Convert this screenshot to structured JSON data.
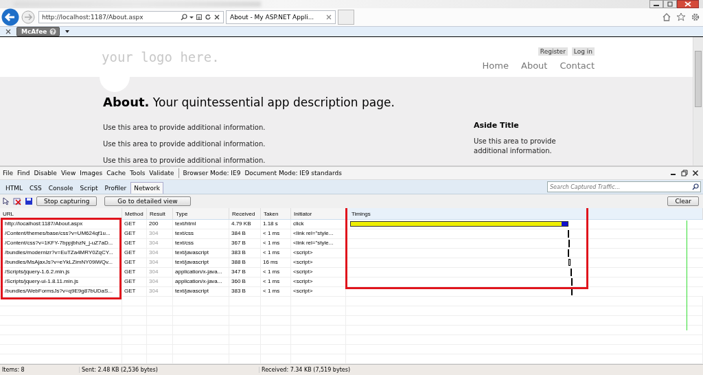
{
  "browser": {
    "address": "http://localhost:1187/About.aspx",
    "tab": "About - My ASP.NET Appli...",
    "addon": "McAfee"
  },
  "page": {
    "logo": "your logo here.",
    "account_links": [
      "Register",
      "Log in"
    ],
    "nav": [
      "Home",
      "About",
      "Contact"
    ],
    "heading": {
      "title": "About.",
      "subtitle": "Your quintessential app description page."
    },
    "paragraphs": [
      "Use this area to provide additional information.",
      "Use this area to provide additional information.",
      "Use this area to provide additional information."
    ],
    "aside": {
      "title": "Aside Title",
      "text": "Use this area to provide additional information."
    }
  },
  "devtools": {
    "menu": [
      "File",
      "Find",
      "Disable",
      "View",
      "Images",
      "Cache",
      "Tools",
      "Validate"
    ],
    "modes": [
      "Browser Mode: IE9",
      "Document Mode: IE9 standards"
    ],
    "tabs": [
      {
        "label": "HTML",
        "selected": false
      },
      {
        "label": "CSS",
        "selected": false
      },
      {
        "label": "Console",
        "selected": false
      },
      {
        "label": "Script",
        "selected": false
      },
      {
        "label": "Profiler",
        "selected": false
      },
      {
        "label": "Network",
        "selected": true
      }
    ],
    "search": {
      "placeholder": "Search Captured Traffic..."
    },
    "buttons": [
      "Stop capturing",
      "Go to detailed view"
    ],
    "clear_button": "Clear",
    "columns": [
      "URL",
      "Method",
      "Result",
      "Type",
      "Received",
      "Taken",
      "Initiator",
      "Timings"
    ],
    "rows": [
      {
        "url": "http://localhost:1187/About.aspx",
        "method": "GET",
        "result": "200",
        "cached": false,
        "type": "text/html",
        "received": "4.79 KB",
        "taken": "1.18 s",
        "initiator": "click",
        "kind": "bar",
        "level": 0.625
      },
      {
        "url": "/Content/themes/base/css?v=UM624qf1u...",
        "method": "GET",
        "result": "304",
        "cached": true,
        "type": "text/css",
        "received": "384 B",
        "taken": "< 1 ms",
        "initiator": "<link rel=\"style...",
        "kind": "tick",
        "level": 0.628
      },
      {
        "url": "/Content/css?v=1KFY-7bppjbhzN_j-uZ7aD...",
        "method": "GET",
        "result": "304",
        "cached": true,
        "type": "text/css",
        "received": "367 B",
        "taken": "< 1 ms",
        "initiator": "<link rel=\"style...",
        "kind": "tick",
        "level": 0.629
      },
      {
        "url": "/bundles/modernizr?v=EuTZa4MRY0ZqCY...",
        "method": "GET",
        "result": "304",
        "cached": true,
        "type": "text/javascript",
        "received": "383 B",
        "taken": "< 1 ms",
        "initiator": "<script>",
        "kind": "tick",
        "level": 0.628
      },
      {
        "url": "/bundles/MsAjaxJs?v=eYkLZimNY09iWQv...",
        "method": "GET",
        "result": "304",
        "cached": true,
        "type": "text/javascript",
        "received": "388 B",
        "taken": "16 ms",
        "initiator": "<script>",
        "kind": "block",
        "level": 0.631
      },
      {
        "url": "/Scripts/jquery-1.6.2.min.js",
        "method": "GET",
        "result": "304",
        "cached": true,
        "type": "application/x-java...",
        "received": "347 B",
        "taken": "< 1 ms",
        "initiator": "<script>",
        "kind": "tick",
        "level": 0.636
      },
      {
        "url": "/Scripts/jquery-ui-1.8.11.min.js",
        "method": "GET",
        "result": "304",
        "cached": true,
        "type": "application/x-java...",
        "received": "360 B",
        "taken": "< 1 ms",
        "initiator": "<script>",
        "kind": "tick",
        "level": 0.637
      },
      {
        "url": "/bundles/WebFormsJs?v=q9E9g87bUDaS...",
        "method": "GET",
        "result": "304",
        "cached": true,
        "type": "text/javascript",
        "received": "383 B",
        "taken": "< 1 ms",
        "initiator": "<script>",
        "kind": "tick",
        "level": 0.637
      }
    ],
    "status": {
      "items": "Items: 8",
      "sent": "Sent: 2.48 KB (2,536 bytes)",
      "received": "Received: 7.34 KB (7,519 bytes)"
    }
  }
}
